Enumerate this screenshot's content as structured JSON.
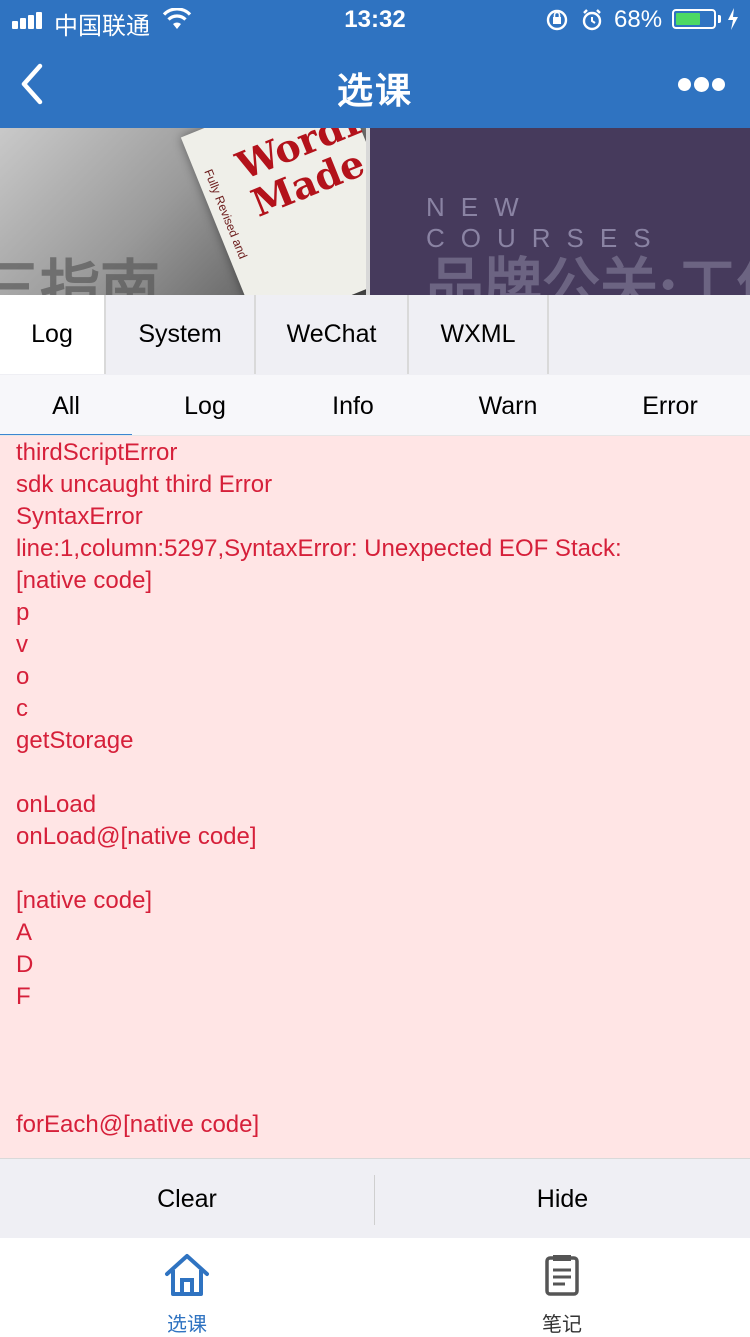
{
  "status_bar": {
    "carrier": "中国联通",
    "time": "13:32",
    "battery": "68%",
    "battery_level": 0.68
  },
  "nav": {
    "title": "选课"
  },
  "banner": {
    "left_book_title": "WordPow\nMade Ea",
    "left_book_subtitle": "Fully Revised and",
    "left_overlay_text": "三指南",
    "right_tagline": "NEW COURSES",
    "right_overlay_text": "品牌公关·工作"
  },
  "console": {
    "tabs": [
      "Log",
      "System",
      "WeChat",
      "WXML"
    ],
    "active_tab": "Log",
    "subtabs": [
      "All",
      "Log",
      "Info",
      "Warn",
      "Error"
    ],
    "active_subtab": "All",
    "log_lines": [
      "thirdScriptError",
      "sdk uncaught third Error",
      "SyntaxError",
      "line:1,column:5297,SyntaxError: Unexpected EOF Stack:",
      "[native code]",
      "p",
      "v",
      "o",
      "c",
      "getStorage",
      "",
      "onLoad",
      "onLoad@[native code]",
      "",
      "[native code]",
      "A",
      "D",
      "F",
      "",
      "",
      "",
      "forEach@[native code]"
    ],
    "colors": {
      "error_text": "#d6203a",
      "error_bg": "#ffe5e5"
    },
    "toolbar": {
      "clear_label": "Clear",
      "hide_label": "Hide"
    }
  },
  "tabbar": {
    "items": [
      {
        "label": "选课",
        "icon": "home-icon",
        "active": true
      },
      {
        "label": "笔记",
        "icon": "notes-icon",
        "active": false
      }
    ],
    "active_color": "#2f73c1",
    "inactive_color": "#333333"
  }
}
